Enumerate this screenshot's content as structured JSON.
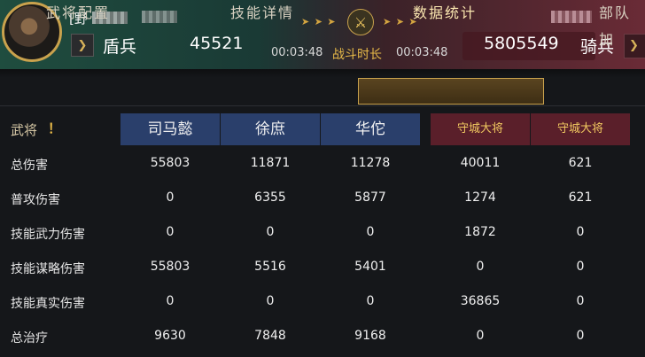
{
  "header": {
    "player_name": "[野",
    "left_unit": "盾兵",
    "left_power": "45521",
    "timer_left": "00:03:48",
    "battle_label": "战斗时长",
    "timer_right": "00:03:48",
    "right_power": "5805549",
    "right_unit": "骑兵",
    "arrows_left": "➤ ➤ ➤",
    "arrows_right": "➤ ➤ ➤"
  },
  "tabs": [
    {
      "label": "武将配置"
    },
    {
      "label": "技能详情"
    },
    {
      "label": "数据统计"
    },
    {
      "label": "部队加"
    }
  ],
  "table": {
    "corner_label": "武将",
    "corner_mark": "！",
    "columns": [
      "司马懿",
      "徐庶",
      "华佗",
      "守城大将",
      "守城大将"
    ],
    "rows": [
      {
        "label": "总伤害",
        "values": [
          "55803",
          "11871",
          "11278",
          "40011",
          "621"
        ]
      },
      {
        "label": "普攻伤害",
        "values": [
          "0",
          "6355",
          "5877",
          "1274",
          "621"
        ]
      },
      {
        "label": "技能武力伤害",
        "values": [
          "0",
          "0",
          "0",
          "1872",
          "0"
        ]
      },
      {
        "label": "技能谋略伤害",
        "values": [
          "55803",
          "5516",
          "5401",
          "0",
          "0"
        ]
      },
      {
        "label": "技能真实伤害",
        "values": [
          "0",
          "0",
          "0",
          "36865",
          "0"
        ]
      },
      {
        "label": "总治疗",
        "values": [
          "9630",
          "7848",
          "9168",
          "0",
          "0"
        ]
      }
    ]
  },
  "colors": {
    "ally_column": "#2a3f6b",
    "enemy_column": "#5a1f2a",
    "gold_accent": "#c9a24d"
  },
  "icons": [
    "avatar",
    "shield-unit-icon",
    "crossed-swords-icon",
    "cavalry-unit-icon"
  ]
}
